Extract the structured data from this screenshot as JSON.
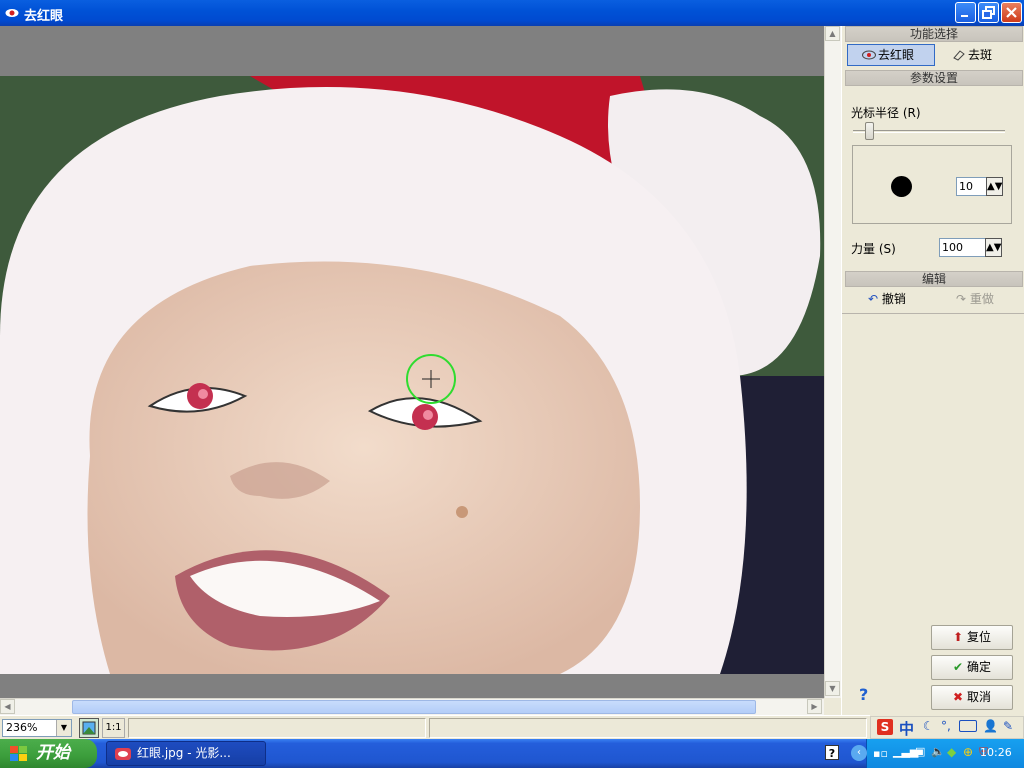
{
  "window": {
    "title": "去红眼"
  },
  "panel": {
    "function_header": "功能选择",
    "tab_redeye": "去红眼",
    "tab_spot": "去斑",
    "params_header": "参数设置",
    "cursor_radius_label": "光标半径",
    "cursor_radius_key": "(R)",
    "cursor_radius_value": "10",
    "strength_label": "力量",
    "strength_key": "(S)",
    "strength_value": "100",
    "edit_header": "编辑",
    "undo_label": "撤销",
    "redo_label": "重做",
    "reset_label": "复位",
    "ok_label": "确定",
    "cancel_label": "取消"
  },
  "statusbar": {
    "zoom": "236%",
    "actual_size": "1:1"
  },
  "taskbar": {
    "start_label": "开始",
    "task_label": "红眼.jpg - 光影...",
    "clock": "10:26",
    "ime_label": "中"
  },
  "colors": {
    "accent": "#316ac5",
    "marker": "#2fdc2f"
  }
}
